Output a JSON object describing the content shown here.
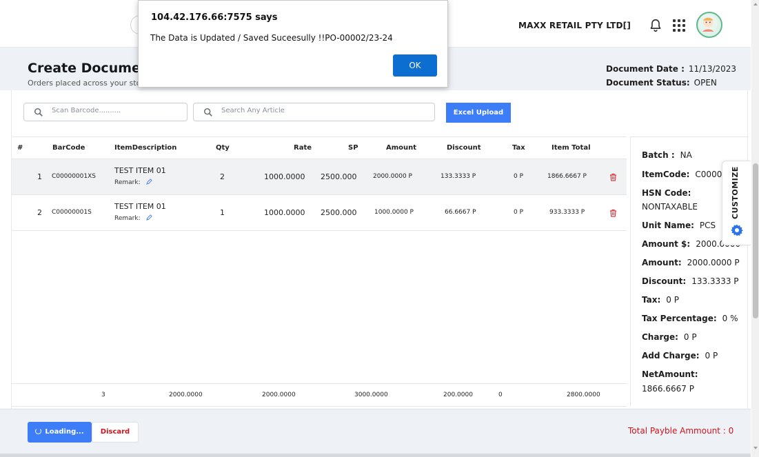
{
  "header": {
    "company": "MAXX RETAIL PTY LTD[]"
  },
  "page": {
    "title": "Create Documen",
    "subtitle": "Orders placed across your stor",
    "document_date_label": "Document Date :",
    "document_date": "11/13/2023",
    "document_status_label": "Document Status:",
    "document_status": "OPEN"
  },
  "search": {
    "barcode_placeholder": "Scan Barcode..........",
    "article_placeholder": "Search Any Article",
    "excel_upload": "Excel Upload"
  },
  "table": {
    "columns": [
      "#",
      "BarCode",
      "ItemDescription",
      "Qty",
      "Rate",
      "SP",
      "Amount",
      "Discount",
      "Tax",
      "Item Total"
    ],
    "remark_label": "Remark:",
    "rows": [
      {
        "no": "1",
        "barcode": "C00000001XS",
        "description": "TEST ITEM  01",
        "qty": "2",
        "rate": "1000.0000",
        "sp": "2500.000",
        "amount": "2000.0000 P",
        "discount": "133.3333 P",
        "tax": "0 P",
        "item_total": "1866.6667 P"
      },
      {
        "no": "2",
        "barcode": "C00000001S",
        "description": "TEST ITEM  01",
        "qty": "1",
        "rate": "1000.0000",
        "sp": "2500.000",
        "amount": "1000.0000 P",
        "discount": "66.6667 P",
        "tax": "0 P",
        "item_total": "933.3333 P"
      }
    ],
    "footer": {
      "qty": "3",
      "rate": "2000.0000",
      "sp": "2000.0000",
      "amount": "3000.0000",
      "discount": "200.0000",
      "tax": "0",
      "item_total": "2800.0000"
    }
  },
  "detail": {
    "batch_label": "Batch :",
    "batch": "NA",
    "itemcode_label": "ItemCode:",
    "itemcode": "C000000",
    "hsn_label": "HSN Code:",
    "hsn": "NONTAXABLE",
    "unit_label": "Unit Name:",
    "unit": "PCS",
    "amount_usd_label": "Amount $:",
    "amount_usd": "2000.0000",
    "amount_label": "Amount:",
    "amount": "2000.0000 P",
    "discount_label": "Discount:",
    "discount": "133.3333 P",
    "tax_label": "Tax:",
    "tax": "0 P",
    "tax_pct_label": "Tax Percentage:",
    "tax_pct": "0 %",
    "charge_label": "Charge:",
    "charge": "0 P",
    "add_charge_label": "Add Charge:",
    "add_charge": "0 P",
    "net_label": "NetAmount:",
    "net": "1866.6667 P"
  },
  "customize": {
    "label": "CUSTOMIZE"
  },
  "footer": {
    "loading": "Loading...",
    "discard": "Discard",
    "total": "Total Payble Ammount : 0"
  },
  "dialog": {
    "title": "104.42.176.66:7575 says",
    "message": "The Data is Updated / Saved Suceesully !!PO-00002/23-24",
    "ok": "OK"
  }
}
